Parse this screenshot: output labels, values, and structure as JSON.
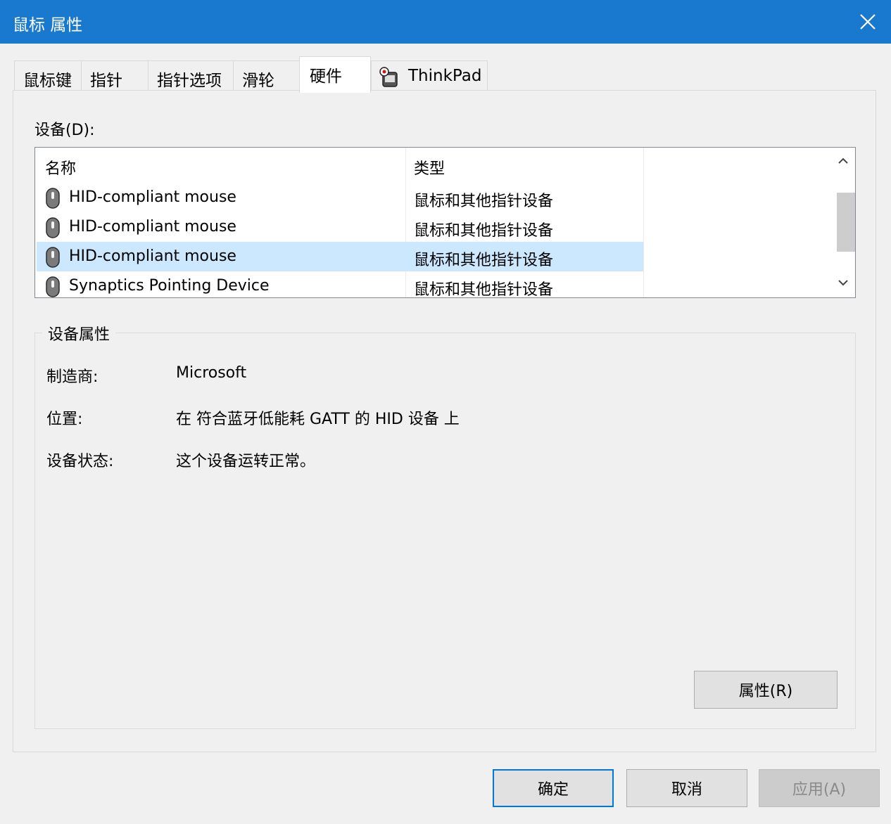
{
  "window": {
    "title": "鼠标 属性"
  },
  "tabs": [
    {
      "label": "鼠标键"
    },
    {
      "label": "指针"
    },
    {
      "label": "指针选项"
    },
    {
      "label": "滑轮"
    },
    {
      "label": "硬件"
    },
    {
      "label": "ThinkPad",
      "icon": "thinkpad-mouse-icon"
    }
  ],
  "active_tab": "硬件",
  "devices": {
    "label": "设备(D):",
    "columns": [
      "名称",
      "类型"
    ],
    "rows": [
      {
        "name": "HID-compliant mouse",
        "type": "鼠标和其他指针设备",
        "icon": "mouse-icon"
      },
      {
        "name": "HID-compliant mouse",
        "type": "鼠标和其他指针设备",
        "icon": "mouse-icon"
      },
      {
        "name": "HID-compliant mouse",
        "type": "鼠标和其他指针设备",
        "icon": "mouse-icon",
        "selected": true
      },
      {
        "name": "Synaptics Pointing Device",
        "type": "鼠标和其他指针设备",
        "icon": "mouse-icon"
      }
    ]
  },
  "properties": {
    "title": "设备属性",
    "manufacturer_label": "制造商:",
    "manufacturer_value": "Microsoft",
    "location_label": "位置:",
    "location_value": "在 符合蓝牙低能耗 GATT 的 HID 设备 上",
    "status_label": "设备状态:",
    "status_value": "这个设备运转正常。",
    "properties_button": "属性(R)"
  },
  "buttons": {
    "ok": "确定",
    "cancel": "取消",
    "apply": "应用(A)"
  },
  "colors": {
    "titlebar": "#1979cf",
    "selection": "#cce8ff",
    "primary_border": "#0078d7"
  }
}
